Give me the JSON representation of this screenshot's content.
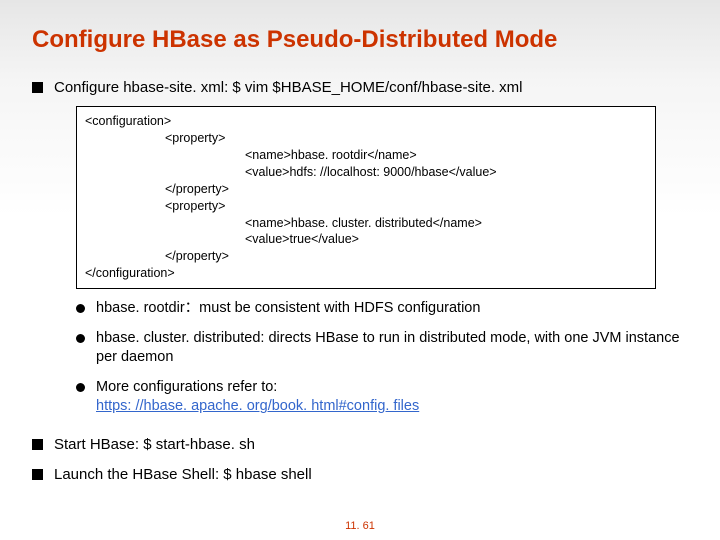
{
  "title": "Configure HBase as Pseudo-Distributed Mode",
  "bullets": {
    "b1": "Configure hbase-site. xml: $ vim $HBASE_HOME/conf/hbase-site. xml",
    "b2": "Start HBase: $ start-hbase. sh",
    "b3": "Launch the HBase Shell: $ hbase shell"
  },
  "code": {
    "l1": "<configuration>",
    "l2": "<property>",
    "l3": "<name>hbase. rootdir</name>",
    "l4": "<value>hdfs: //localhost: 9000/hbase</value>",
    "l5": "</property>",
    "l6": "<property>",
    "l7": "<name>hbase. cluster. distributed</name>",
    "l8": "<value>true</value>",
    "l9": "</property>",
    "l10": "</configuration>"
  },
  "sub": {
    "s1a": "hbase. rootdir",
    "s1b": "：must be consistent with HDFS configuration",
    "s2": "hbase. cluster. distributed: directs HBase to run in distributed mode, with one JVM instance per daemon",
    "s3": "More configurations refer to:",
    "s3link": "https: //hbase. apache. org/book. html#config. files"
  },
  "pagenum": "11. 61"
}
